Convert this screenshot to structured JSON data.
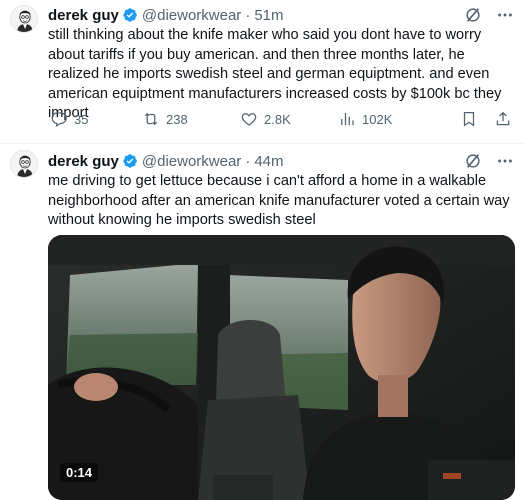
{
  "tweets": [
    {
      "author_name": "derek guy",
      "handle": "@dieworkwear",
      "separator": "·",
      "time": "51m",
      "text": "still thinking about the knife maker who said you dont have to worry about tariffs if you buy american. and then three months later, he realized he imports swedish steel and german equiptment. and even american equiptment manufacturers increased costs by $100k bc they import",
      "replies": "35",
      "reposts": "238",
      "likes": "2.8K",
      "views": "102K"
    },
    {
      "author_name": "derek guy",
      "handle": "@dieworkwear",
      "separator": "·",
      "time": "44m",
      "text": "me driving to get lettuce because i can't afford a home in a walkable neighborhood after an american knife manufacturer voted a certain way without knowing he imports swedish steel",
      "media": {
        "type": "video",
        "duration": "0:14"
      }
    }
  ],
  "icons": {
    "verified": "verified-badge-icon",
    "grok": "grok-icon",
    "more": "more-icon",
    "reply": "reply-icon",
    "repost": "repost-icon",
    "like": "like-icon",
    "views": "views-icon",
    "bookmark": "bookmark-icon",
    "share": "share-icon"
  },
  "colors": {
    "text_primary": "#0f1419",
    "text_secondary": "#536471",
    "verified_blue": "#1d9bf0",
    "divider": "#eff3f4"
  }
}
